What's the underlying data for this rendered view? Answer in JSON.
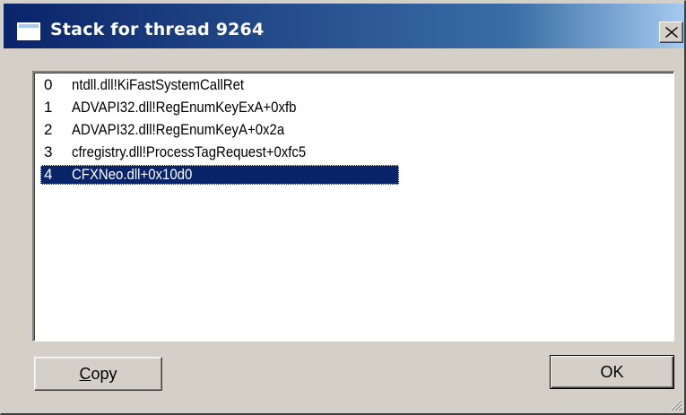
{
  "window": {
    "title": "Stack for thread 9264"
  },
  "stack": {
    "frames": [
      {
        "index": "0",
        "text": "ntdll.dll!KiFastSystemCallRet"
      },
      {
        "index": "1",
        "text": "ADVAPI32.dll!RegEnumKeyExA+0xfb"
      },
      {
        "index": "2",
        "text": "ADVAPI32.dll!RegEnumKeyA+0x2a"
      },
      {
        "index": "3",
        "text": "cfregistry.dll!ProcessTagRequest+0xfc5"
      },
      {
        "index": "4",
        "text": "CFXNeo.dll+0x10d0"
      }
    ],
    "selected_index": 4
  },
  "buttons": {
    "copy_accel": "C",
    "copy_rest": "opy",
    "ok_label": "OK"
  },
  "colors": {
    "selection": "#0a246a",
    "face": "#d4d0c8"
  },
  "icons": {
    "title": "window-icon",
    "close": "close-icon",
    "grip": "resize-grip-icon"
  }
}
